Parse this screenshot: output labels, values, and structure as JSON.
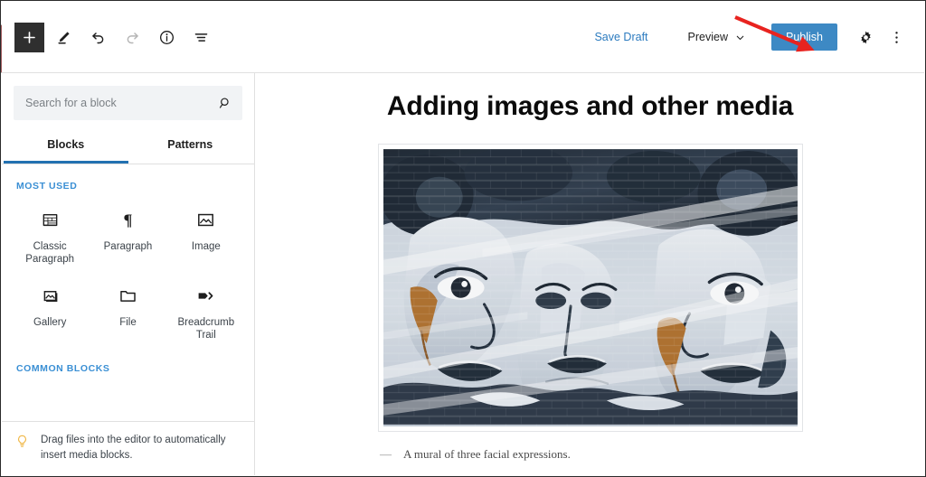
{
  "app": {
    "name": "WordPress Block Editor",
    "accent_blue": "#3d89c4",
    "link_blue": "#2c7bbf",
    "heading_blue": "#3a8fd4",
    "annotation_red": "#e8231f",
    "admin_strip_color": "#a05a5c"
  },
  "toolbar": {
    "add_block_label": "+",
    "add_block_name": "Toggle block inserter",
    "tools": [
      {
        "name": "edit-tool",
        "label": "Edit",
        "disabled": false
      },
      {
        "name": "undo",
        "label": "Undo",
        "disabled": false
      },
      {
        "name": "redo",
        "label": "Redo",
        "disabled": true
      },
      {
        "name": "details",
        "label": "Details",
        "disabled": false
      },
      {
        "name": "list-view",
        "label": "List View",
        "disabled": false
      }
    ],
    "save_draft_label": "Save Draft",
    "preview_label": "Preview",
    "publish_label": "Publish",
    "settings_label": "Settings",
    "options_label": "Options"
  },
  "annotation": {
    "type": "arrow",
    "color": "#e8231f",
    "points_to": "Publish"
  },
  "inserter": {
    "search": {
      "placeholder": "Search for a block",
      "value": ""
    },
    "tabs": [
      {
        "label": "Blocks",
        "active": true
      },
      {
        "label": "Patterns",
        "active": false
      }
    ],
    "sections": [
      {
        "heading": "MOST USED",
        "blocks": [
          {
            "label": "Classic Paragraph",
            "icon": "classic-paragraph-icon"
          },
          {
            "label": "Paragraph",
            "icon": "paragraph-icon"
          },
          {
            "label": "Image",
            "icon": "image-icon"
          },
          {
            "label": "Gallery",
            "icon": "gallery-icon"
          },
          {
            "label": "File",
            "icon": "file-icon"
          },
          {
            "label": "Breadcrumb Trail",
            "icon": "breadcrumb-trail-icon"
          }
        ]
      },
      {
        "heading": "COMMON BLOCKS",
        "blocks": []
      }
    ],
    "tip": {
      "icon": "lightbulb-icon",
      "text": "Drag files into the editor to automatically insert media blocks."
    }
  },
  "editor": {
    "post_title": "Adding images and other media",
    "image_block": {
      "alt": "A mural of three fragmented faces painted in blue-grey and black with orange accents on a brick wall",
      "caption_dash": "—",
      "caption": "A mural of three facial expressions."
    }
  }
}
